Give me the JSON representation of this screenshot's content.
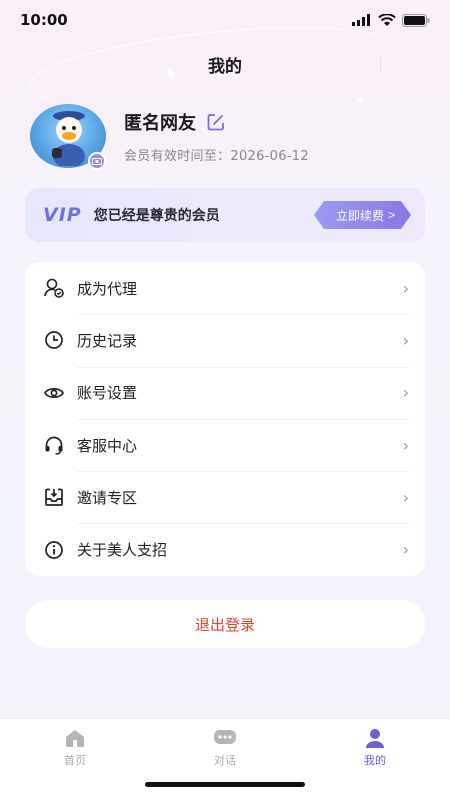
{
  "status_bar": {
    "time": "10:00"
  },
  "header": {
    "title": "我的"
  },
  "profile": {
    "username": "匿名网友",
    "member_expiry": "会员有效时间至：2026-06-12"
  },
  "vip": {
    "logo": "VIP",
    "text": "您已经是尊贵的会员",
    "renew_label": "立即续费",
    "renew_arrow": ">"
  },
  "menu": {
    "items": [
      {
        "label": "成为代理",
        "icon": "agent-icon"
      },
      {
        "label": "历史记录",
        "icon": "history-icon"
      },
      {
        "label": "账号设置",
        "icon": "eye-icon"
      },
      {
        "label": "客服中心",
        "icon": "headset-icon"
      },
      {
        "label": "邀请专区",
        "icon": "inbox-icon"
      },
      {
        "label": "关于美人支招",
        "icon": "info-icon"
      }
    ]
  },
  "logout": {
    "label": "退出登录"
  },
  "tabs": [
    {
      "label": "首页",
      "icon": "home-icon",
      "active": false
    },
    {
      "label": "对话",
      "icon": "chat-icon",
      "active": false
    },
    {
      "label": "我的",
      "icon": "person-icon",
      "active": true
    }
  ],
  "colors": {
    "accent": "#6e5fd3",
    "logout": "#e0453c",
    "vip": "#6f72d8"
  }
}
